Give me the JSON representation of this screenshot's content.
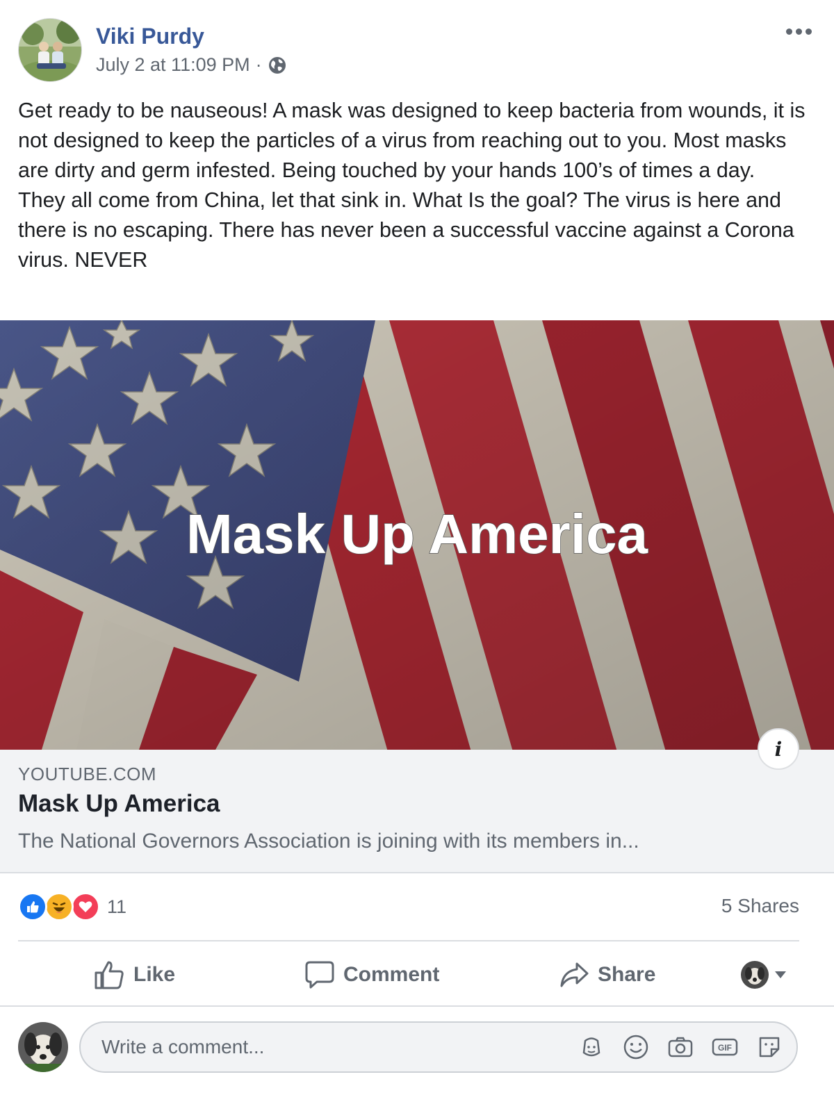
{
  "post": {
    "author": "Viki Purdy",
    "timestamp": "July 2 at 11:09 PM",
    "separator": "·",
    "privacy_icon": "globe-icon",
    "body": "Get ready to be nauseous! A mask was designed to keep bacteria from wounds, it is not designed to keep the particles of a virus from reaching out to you. Most masks are dirty and germ infested. Being touched by your hands 100’s of times a day.\nThey all come from China, let that sink in. What Is the goal? The virus is here and there is no escaping. There has never been a successful vaccine against a Corona virus. NEVER"
  },
  "link_preview": {
    "image_text": "Mask Up America",
    "domain": "YOUTUBE.COM",
    "title": "Mask Up America",
    "description": "The National Governors Association is joining with its members in...",
    "info_label": "i"
  },
  "engagement": {
    "reaction_count": "11",
    "reactions": [
      "like-reaction-icon",
      "haha-reaction-icon",
      "love-reaction-icon"
    ],
    "shares": "5 Shares"
  },
  "actions": {
    "like": "Like",
    "comment": "Comment",
    "share": "Share"
  },
  "comment_box": {
    "placeholder": "Write a comment..."
  },
  "colors": {
    "author": "#385898",
    "secondary_text": "#606770",
    "like_blue": "#1877f2",
    "love_red": "#f33e58",
    "haha_yellow": "#f7b125"
  }
}
